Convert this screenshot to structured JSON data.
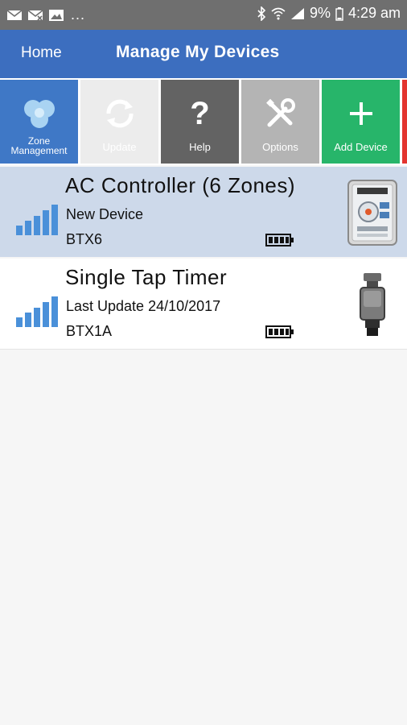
{
  "status_bar": {
    "overflow": "...",
    "battery": "9%",
    "time": "4:29 am",
    "icons": [
      "mail-icon",
      "mail-dismiss-icon",
      "image-icon",
      "bluetooth-icon",
      "wifi-icon",
      "cell-signal-icon",
      "battery-icon"
    ]
  },
  "header": {
    "home_label": "Home",
    "title": "Manage My Devices",
    "bg_color": "#3c6ebf"
  },
  "toolbar": {
    "zone_label": "Zone Management",
    "update_label": "Update",
    "help_label": "Help",
    "options_label": "Options",
    "add_label": "Add Device"
  },
  "devices": [
    {
      "name": "AC Controller (6 Zones)",
      "status": "New Device",
      "model": "BTX6",
      "signal_bars": 5,
      "battery_level": 1.0,
      "thumbnail": "ac-controller-icon"
    },
    {
      "name": "Single Tap Timer",
      "status": "Last Update 24/10/2017",
      "model": "BTX1A",
      "signal_bars": 5,
      "battery_level": 1.0,
      "thumbnail": "tap-timer-icon"
    }
  ]
}
